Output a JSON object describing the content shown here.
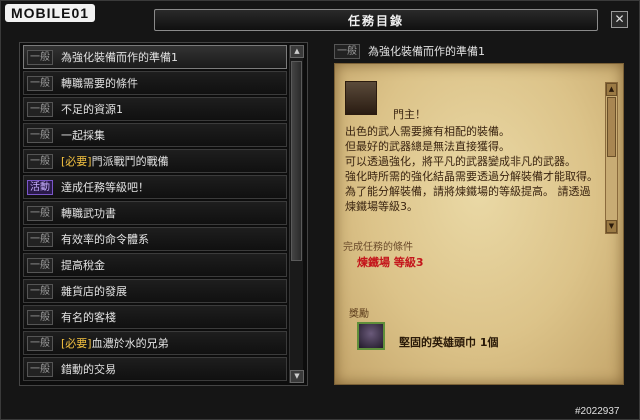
{
  "brand": {
    "logo_text": "MOBILE01"
  },
  "window": {
    "title": "任務目錄",
    "close_label": "✕"
  },
  "quest_list": {
    "items": [
      {
        "category": "一般",
        "prefix": "",
        "label": "為強化裝備而作的準備1",
        "selected": true
      },
      {
        "category": "一般",
        "prefix": "",
        "label": "轉職需要的條件"
      },
      {
        "category": "一般",
        "prefix": "",
        "label": "不足的資源1"
      },
      {
        "category": "一般",
        "prefix": "",
        "label": "一起採集"
      },
      {
        "category": "一般",
        "prefix": "[必要]",
        "label": "門派戰鬥的戰備"
      },
      {
        "category": "活動",
        "prefix": "",
        "label": "達成任務等級吧！",
        "event": true
      },
      {
        "category": "一般",
        "prefix": "",
        "label": "轉職武功書"
      },
      {
        "category": "一般",
        "prefix": "",
        "label": "有效率的命令體系"
      },
      {
        "category": "一般",
        "prefix": "",
        "label": "提高稅金"
      },
      {
        "category": "一般",
        "prefix": "",
        "label": "雜貨店的發展"
      },
      {
        "category": "一般",
        "prefix": "",
        "label": "有名的客棧"
      },
      {
        "category": "一般",
        "prefix": "[必要]",
        "label": "血濃於水的兄弟"
      },
      {
        "category": "一般",
        "prefix": "",
        "label": "錯動的交易"
      }
    ]
  },
  "detail": {
    "category": "一般",
    "title": "為強化裝備而作的準備1",
    "npc_greeting": "門主！",
    "description_lines": [
      "出色的武人需要擁有相配的裝備。",
      "但最好的武器總是無法直接獲得。",
      "可以透過強化，將平凡的武器變成非凡的武器。",
      "強化時所需的強化結晶需要透過分解裝備才能取得。",
      "為了能分解裝備，請將煉鐵場的等級提高。 請透過煉鐵場等級3。"
    ],
    "condition_title": "完成任務的條件",
    "condition_value": "煉鐵場 等級3",
    "reward_title": "獎勵",
    "reward_item": "堅固的英雄頭巾 1個"
  },
  "watermark": "#2022937"
}
